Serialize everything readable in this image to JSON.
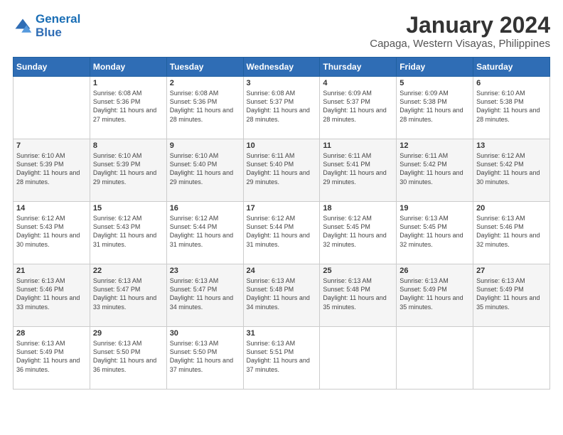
{
  "header": {
    "logo_line1": "General",
    "logo_line2": "Blue",
    "title": "January 2024",
    "subtitle": "Capaga, Western Visayas, Philippines"
  },
  "days_of_week": [
    "Sunday",
    "Monday",
    "Tuesday",
    "Wednesday",
    "Thursday",
    "Friday",
    "Saturday"
  ],
  "weeks": [
    [
      {
        "day": "",
        "sunrise": "",
        "sunset": "",
        "daylight": ""
      },
      {
        "day": "1",
        "sunrise": "Sunrise: 6:08 AM",
        "sunset": "Sunset: 5:36 PM",
        "daylight": "Daylight: 11 hours and 27 minutes."
      },
      {
        "day": "2",
        "sunrise": "Sunrise: 6:08 AM",
        "sunset": "Sunset: 5:36 PM",
        "daylight": "Daylight: 11 hours and 28 minutes."
      },
      {
        "day": "3",
        "sunrise": "Sunrise: 6:08 AM",
        "sunset": "Sunset: 5:37 PM",
        "daylight": "Daylight: 11 hours and 28 minutes."
      },
      {
        "day": "4",
        "sunrise": "Sunrise: 6:09 AM",
        "sunset": "Sunset: 5:37 PM",
        "daylight": "Daylight: 11 hours and 28 minutes."
      },
      {
        "day": "5",
        "sunrise": "Sunrise: 6:09 AM",
        "sunset": "Sunset: 5:38 PM",
        "daylight": "Daylight: 11 hours and 28 minutes."
      },
      {
        "day": "6",
        "sunrise": "Sunrise: 6:10 AM",
        "sunset": "Sunset: 5:38 PM",
        "daylight": "Daylight: 11 hours and 28 minutes."
      }
    ],
    [
      {
        "day": "7",
        "sunrise": "Sunrise: 6:10 AM",
        "sunset": "Sunset: 5:39 PM",
        "daylight": "Daylight: 11 hours and 28 minutes."
      },
      {
        "day": "8",
        "sunrise": "Sunrise: 6:10 AM",
        "sunset": "Sunset: 5:39 PM",
        "daylight": "Daylight: 11 hours and 29 minutes."
      },
      {
        "day": "9",
        "sunrise": "Sunrise: 6:10 AM",
        "sunset": "Sunset: 5:40 PM",
        "daylight": "Daylight: 11 hours and 29 minutes."
      },
      {
        "day": "10",
        "sunrise": "Sunrise: 6:11 AM",
        "sunset": "Sunset: 5:40 PM",
        "daylight": "Daylight: 11 hours and 29 minutes."
      },
      {
        "day": "11",
        "sunrise": "Sunrise: 6:11 AM",
        "sunset": "Sunset: 5:41 PM",
        "daylight": "Daylight: 11 hours and 29 minutes."
      },
      {
        "day": "12",
        "sunrise": "Sunrise: 6:11 AM",
        "sunset": "Sunset: 5:42 PM",
        "daylight": "Daylight: 11 hours and 30 minutes."
      },
      {
        "day": "13",
        "sunrise": "Sunrise: 6:12 AM",
        "sunset": "Sunset: 5:42 PM",
        "daylight": "Daylight: 11 hours and 30 minutes."
      }
    ],
    [
      {
        "day": "14",
        "sunrise": "Sunrise: 6:12 AM",
        "sunset": "Sunset: 5:43 PM",
        "daylight": "Daylight: 11 hours and 30 minutes."
      },
      {
        "day": "15",
        "sunrise": "Sunrise: 6:12 AM",
        "sunset": "Sunset: 5:43 PM",
        "daylight": "Daylight: 11 hours and 31 minutes."
      },
      {
        "day": "16",
        "sunrise": "Sunrise: 6:12 AM",
        "sunset": "Sunset: 5:44 PM",
        "daylight": "Daylight: 11 hours and 31 minutes."
      },
      {
        "day": "17",
        "sunrise": "Sunrise: 6:12 AM",
        "sunset": "Sunset: 5:44 PM",
        "daylight": "Daylight: 11 hours and 31 minutes."
      },
      {
        "day": "18",
        "sunrise": "Sunrise: 6:12 AM",
        "sunset": "Sunset: 5:45 PM",
        "daylight": "Daylight: 11 hours and 32 minutes."
      },
      {
        "day": "19",
        "sunrise": "Sunrise: 6:13 AM",
        "sunset": "Sunset: 5:45 PM",
        "daylight": "Daylight: 11 hours and 32 minutes."
      },
      {
        "day": "20",
        "sunrise": "Sunrise: 6:13 AM",
        "sunset": "Sunset: 5:46 PM",
        "daylight": "Daylight: 11 hours and 32 minutes."
      }
    ],
    [
      {
        "day": "21",
        "sunrise": "Sunrise: 6:13 AM",
        "sunset": "Sunset: 5:46 PM",
        "daylight": "Daylight: 11 hours and 33 minutes."
      },
      {
        "day": "22",
        "sunrise": "Sunrise: 6:13 AM",
        "sunset": "Sunset: 5:47 PM",
        "daylight": "Daylight: 11 hours and 33 minutes."
      },
      {
        "day": "23",
        "sunrise": "Sunrise: 6:13 AM",
        "sunset": "Sunset: 5:47 PM",
        "daylight": "Daylight: 11 hours and 34 minutes."
      },
      {
        "day": "24",
        "sunrise": "Sunrise: 6:13 AM",
        "sunset": "Sunset: 5:48 PM",
        "daylight": "Daylight: 11 hours and 34 minutes."
      },
      {
        "day": "25",
        "sunrise": "Sunrise: 6:13 AM",
        "sunset": "Sunset: 5:48 PM",
        "daylight": "Daylight: 11 hours and 35 minutes."
      },
      {
        "day": "26",
        "sunrise": "Sunrise: 6:13 AM",
        "sunset": "Sunset: 5:49 PM",
        "daylight": "Daylight: 11 hours and 35 minutes."
      },
      {
        "day": "27",
        "sunrise": "Sunrise: 6:13 AM",
        "sunset": "Sunset: 5:49 PM",
        "daylight": "Daylight: 11 hours and 35 minutes."
      }
    ],
    [
      {
        "day": "28",
        "sunrise": "Sunrise: 6:13 AM",
        "sunset": "Sunset: 5:49 PM",
        "daylight": "Daylight: 11 hours and 36 minutes."
      },
      {
        "day": "29",
        "sunrise": "Sunrise: 6:13 AM",
        "sunset": "Sunset: 5:50 PM",
        "daylight": "Daylight: 11 hours and 36 minutes."
      },
      {
        "day": "30",
        "sunrise": "Sunrise: 6:13 AM",
        "sunset": "Sunset: 5:50 PM",
        "daylight": "Daylight: 11 hours and 37 minutes."
      },
      {
        "day": "31",
        "sunrise": "Sunrise: 6:13 AM",
        "sunset": "Sunset: 5:51 PM",
        "daylight": "Daylight: 11 hours and 37 minutes."
      },
      {
        "day": "",
        "sunrise": "",
        "sunset": "",
        "daylight": ""
      },
      {
        "day": "",
        "sunrise": "",
        "sunset": "",
        "daylight": ""
      },
      {
        "day": "",
        "sunrise": "",
        "sunset": "",
        "daylight": ""
      }
    ]
  ]
}
